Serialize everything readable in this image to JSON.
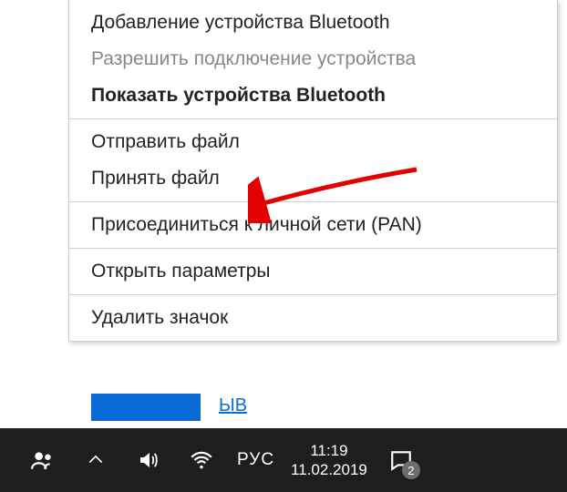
{
  "menu": {
    "group1": {
      "addDevice": "Добавление устройства Bluetooth",
      "allowConnect": "Разрешить подключение устройства",
      "showDevices": "Показать устройства Bluetooth"
    },
    "group2": {
      "sendFile": "Отправить файл",
      "receiveFile": "Принять файл"
    },
    "group3": {
      "joinPan": "Присоединиться к личной сети (PAN)"
    },
    "group4": {
      "openSettings": "Открыть параметры"
    },
    "group5": {
      "removeIcon": "Удалить значок"
    }
  },
  "fragment": {
    "text": "ЫВ"
  },
  "taskbar": {
    "lang": "РУС",
    "time": "11:19",
    "date": "11.02.2019",
    "notifCount": "2"
  }
}
